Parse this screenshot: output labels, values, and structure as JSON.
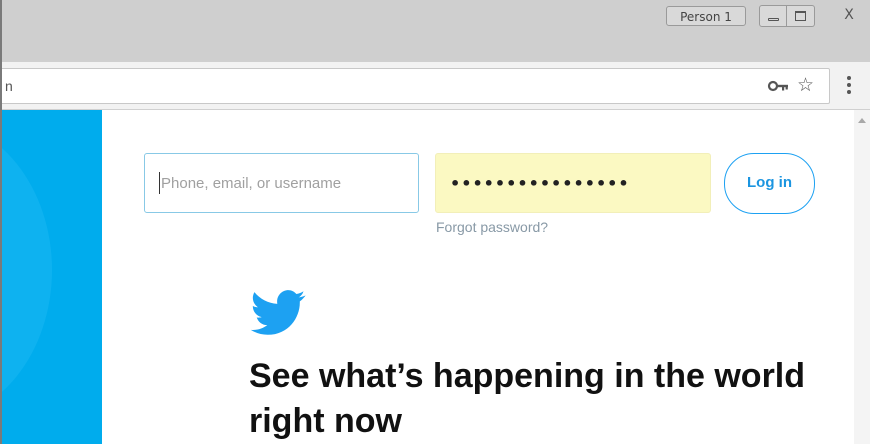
{
  "titlebar": {
    "profile_label": "Person 1",
    "close_glyph": "X",
    "buttons": [
      "minimize",
      "maximize",
      "close"
    ]
  },
  "toolbar": {
    "omnibox_text": "n",
    "icons": [
      "key-icon",
      "star-icon",
      "menu-icon"
    ],
    "star_glyph": "☆"
  },
  "login": {
    "username_placeholder": "Phone, email, or username",
    "password_value": "••••••••••••••••",
    "forgot_label": "Forgot password?",
    "login_label": "Log in"
  },
  "hero": {
    "headline": "See what’s happening in the world right now"
  },
  "colors": {
    "brand": "#1da1f2",
    "hero_band": "#00aced",
    "autofill": "#fbf9c2",
    "muted": "#8899a6"
  }
}
